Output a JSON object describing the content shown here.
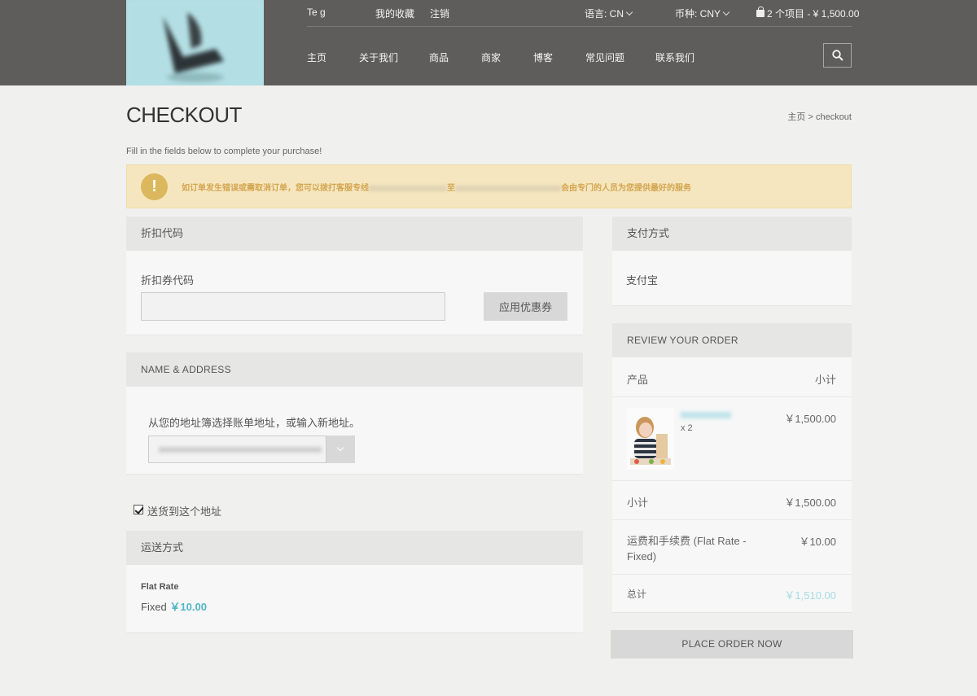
{
  "header": {
    "user_name": "Te          g",
    "favorites": "我的收藏",
    "logout": "注销",
    "language_label": "语言: CN",
    "currency_label": "币种: CNY",
    "cart_summary": "2 个项目 - ¥ 1,500.00",
    "nav": [
      "主页",
      "关于我们",
      "商品",
      "商家",
      "博客",
      "常见问题",
      "联系我们"
    ]
  },
  "page": {
    "title": "CHECKOUT",
    "breadcrumb": "主页 > checkout",
    "subtitle": "Fill in the fields below to complete your purchase!"
  },
  "notice": {
    "part1": "如订单发生错误或需取消订单，您可以拨打客服专线",
    "part2": "至",
    "part3": "会由专门的人员为您提供最好的服务"
  },
  "coupon": {
    "header": "折扣代码",
    "label": "折扣券代码",
    "value": "",
    "button": "应用优惠券"
  },
  "address": {
    "header": "NAME & ADDRESS",
    "label": "从您的地址簿选择账单地址，或输入新地址。",
    "selected": "",
    "ship_here_label": "送货到这个地址",
    "ship_here_checked": true
  },
  "shipping": {
    "header": "运送方式",
    "method_name": "Flat Rate",
    "method_type": "Fixed",
    "method_price": "￥10.00"
  },
  "payment": {
    "header": "支付方式",
    "method": "支付宝"
  },
  "review": {
    "header": "REVIEW YOUR ORDER",
    "col_product": "产品",
    "col_subtotal": "小计",
    "item_name": "",
    "item_qty": "x 2",
    "item_price": "￥1,500.00",
    "subtotal_label": "小计",
    "subtotal_value": "￥1,500.00",
    "shipping_label": "运费和手续费 (Flat Rate - Fixed)",
    "shipping_value": "￥10.00",
    "total_label": "总计",
    "total_value": "￥1,510.00",
    "place_order": "PLACE ORDER NOW"
  },
  "colors": {
    "header_bg": "#5e5d5b",
    "accent": "#4fb6c7",
    "notice_bg": "#f6e6bf"
  }
}
